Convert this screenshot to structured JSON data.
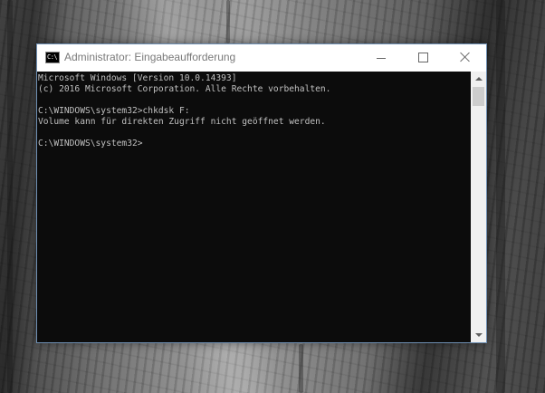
{
  "window": {
    "title": "Administrator: Eingabeaufforderung",
    "icon": "cmd-icon",
    "icon_text": "C:\\",
    "buttons": {
      "minimize": "minimize-icon",
      "maximize": "maximize-icon",
      "close": "close-icon"
    }
  },
  "console": {
    "background": "#0c0c0c",
    "foreground": "#c0c0c0",
    "lines": [
      "Microsoft Windows [Version 10.0.14393]",
      "(c) 2016 Microsoft Corporation. Alle Rechte vorbehalten.",
      "",
      "C:\\WINDOWS\\system32>chkdsk F:",
      "Volume kann für direkten Zugriff nicht geöffnet werden.",
      "",
      "C:\\WINDOWS\\system32>"
    ]
  },
  "scrollbar": {
    "up_icon": "scroll-up-arrow-icon",
    "down_icon": "scroll-down-arrow-icon"
  }
}
